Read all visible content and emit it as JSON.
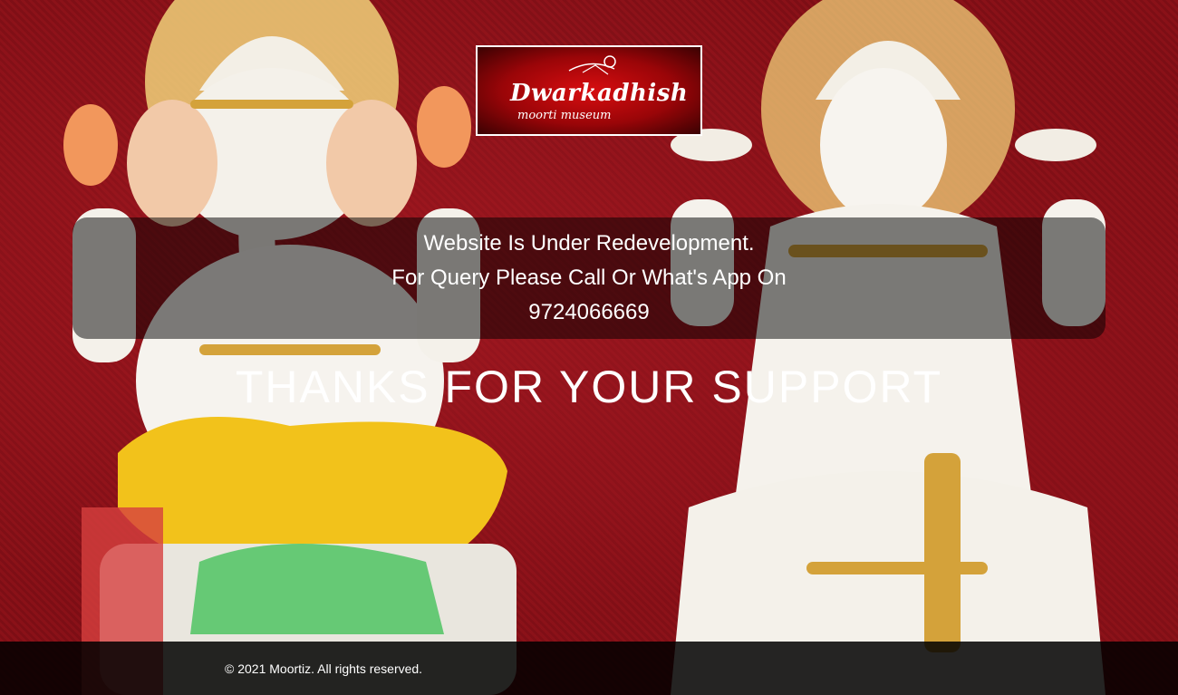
{
  "logo": {
    "title": "Dwarkadhish",
    "subtitle": "moorti museum"
  },
  "notice": {
    "line1": "Website Is Under Redevelopment.",
    "line2": "For Query Please Call Or What's App On",
    "phone": "9724066669"
  },
  "headline": "THANKS FOR YOUR SUPPORT",
  "footer": {
    "copyright": "© 2021 Moortiz. All rights reserved."
  },
  "colors": {
    "background": "#7a0f14",
    "logo_red": "#d80d10",
    "overlay": "rgba(0,0,0,0.5)",
    "text": "#ffffff"
  }
}
